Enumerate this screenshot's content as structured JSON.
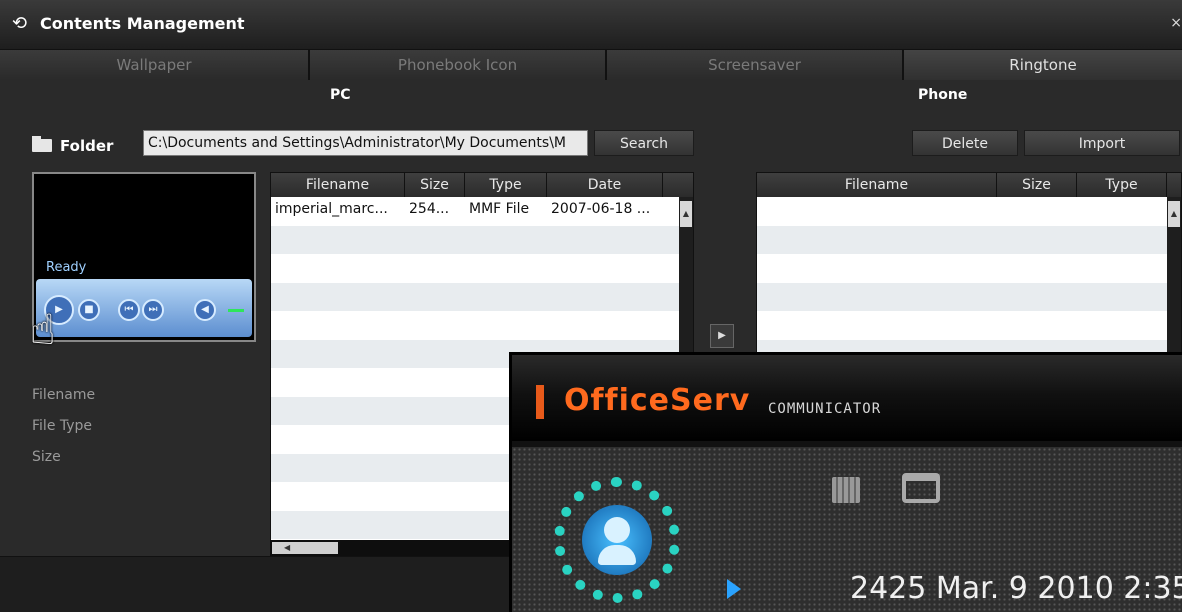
{
  "window": {
    "title": "Contents Management",
    "close": "×"
  },
  "tabs": [
    {
      "label": "Wallpaper",
      "active": false
    },
    {
      "label": "Phonebook Icon",
      "active": false
    },
    {
      "label": "Screensaver",
      "active": false
    },
    {
      "label": "Ringtone",
      "active": true
    }
  ],
  "panels": {
    "pc_title": "PC",
    "phone_title": "Phone"
  },
  "folder": {
    "label": "Folder",
    "path_value": "C:\\Documents and Settings\\Administrator\\My Documents\\M",
    "search_label": "Search"
  },
  "phone_actions": {
    "delete_label": "Delete",
    "import_label": "Import"
  },
  "player": {
    "status": "Ready"
  },
  "file_info": {
    "filename_label": "Filename",
    "filetype_label": "File Type",
    "size_label": "Size"
  },
  "pc_table": {
    "columns": [
      "Filename",
      "Size",
      "Type",
      "Date"
    ],
    "rows": [
      {
        "filename": "imperial_marc...",
        "size": "254...",
        "type": "MMF File",
        "date": "2007-06-18 ..."
      }
    ]
  },
  "phone_table": {
    "columns": [
      "Filename",
      "Size",
      "Type"
    ],
    "rows": []
  },
  "overlay": {
    "brand": "OfficeServ",
    "subtitle": "COMMUNICATOR",
    "status_line": "2425  Mar. 9 2010 2:35"
  },
  "colors": {
    "accent_orange": "#ff6a1e",
    "accent_teal": "#2ad3c2",
    "accent_blue": "#2aa3ff"
  }
}
